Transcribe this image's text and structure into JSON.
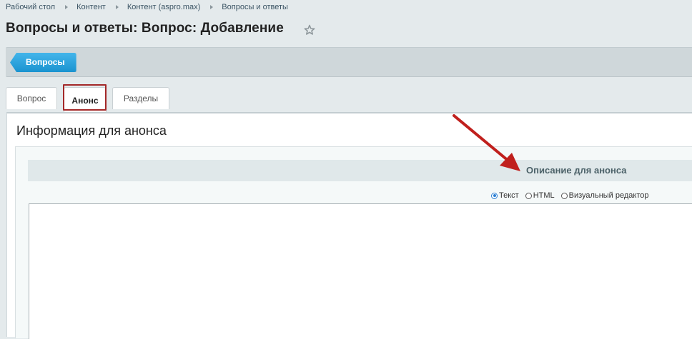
{
  "breadcrumb": [
    "Рабочий стол",
    "Контент",
    "Контент (aspro.max)",
    "Вопросы и ответы"
  ],
  "page": {
    "title": "Вопросы и ответы: Вопрос: Добавление"
  },
  "toolbar": {
    "back_label": "Вопросы"
  },
  "tabs": [
    {
      "label": "Вопрос"
    },
    {
      "label": "Анонс",
      "active": true
    },
    {
      "label": "Разделы"
    }
  ],
  "section": {
    "title": "Информация для анонса"
  },
  "field": {
    "label": "Описание для анонса",
    "format_options": [
      {
        "label": "Текст",
        "selected": true
      },
      {
        "label": "HTML",
        "selected": false
      },
      {
        "label": "Визуальный редактор",
        "selected": false
      }
    ],
    "value": ""
  },
  "colors": {
    "accent": "#1a93d0",
    "highlight": "#a32828",
    "annotation_arrow": "#c0201d"
  },
  "icons": {
    "favorite": "star-icon"
  }
}
